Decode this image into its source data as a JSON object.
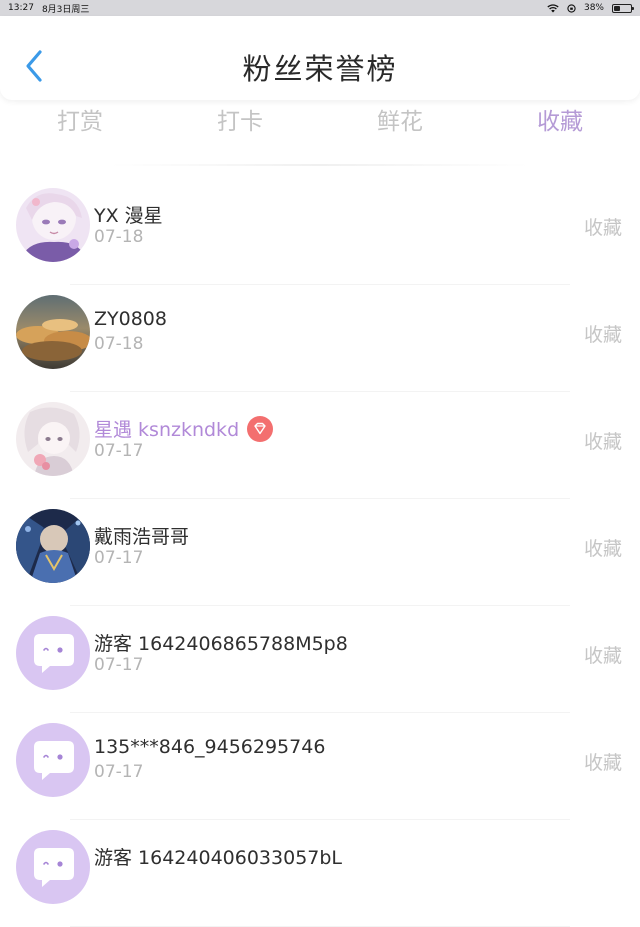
{
  "status_bar": {
    "time": "13:27",
    "date": "8月3日周三",
    "battery": "38%",
    "battery_level": 0.38
  },
  "header": {
    "title": "粉丝荣誉榜",
    "back_icon": "chevron-left-icon",
    "accent_color": "#3b9ae8"
  },
  "tabs": [
    {
      "label": "打赏"
    },
    {
      "label": "打卡"
    },
    {
      "label": "鲜花"
    },
    {
      "label": "收藏"
    }
  ],
  "active_tab_color": "#b59bd6",
  "fans": [
    {
      "name": "YX 漫星",
      "date": "07-18",
      "action": "收藏",
      "avatar": "anime-girl-avatar"
    },
    {
      "name": "ZY0808",
      "date": "07-18",
      "action": "收藏",
      "avatar": "sunset-clouds-avatar"
    },
    {
      "name": "星遇 ksnzkndkd",
      "date": "07-17",
      "action": "收藏",
      "avatar": "anime-girl-avatar-2",
      "vip": true
    },
    {
      "name": "戴雨浩哥哥",
      "date": "07-17",
      "action": "收藏",
      "avatar": "anime-character-avatar"
    },
    {
      "name": "游客 1642406865788M5p8",
      "date": "07-17",
      "action": "收藏",
      "avatar": "guest-chat-avatar"
    },
    {
      "name": "135***846_9456295746",
      "date": "07-17",
      "action": "收藏",
      "avatar": "guest-chat-avatar"
    },
    {
      "name": "游客 164240406033057bL",
      "date": "",
      "action": "",
      "avatar": "guest-chat-avatar"
    }
  ]
}
